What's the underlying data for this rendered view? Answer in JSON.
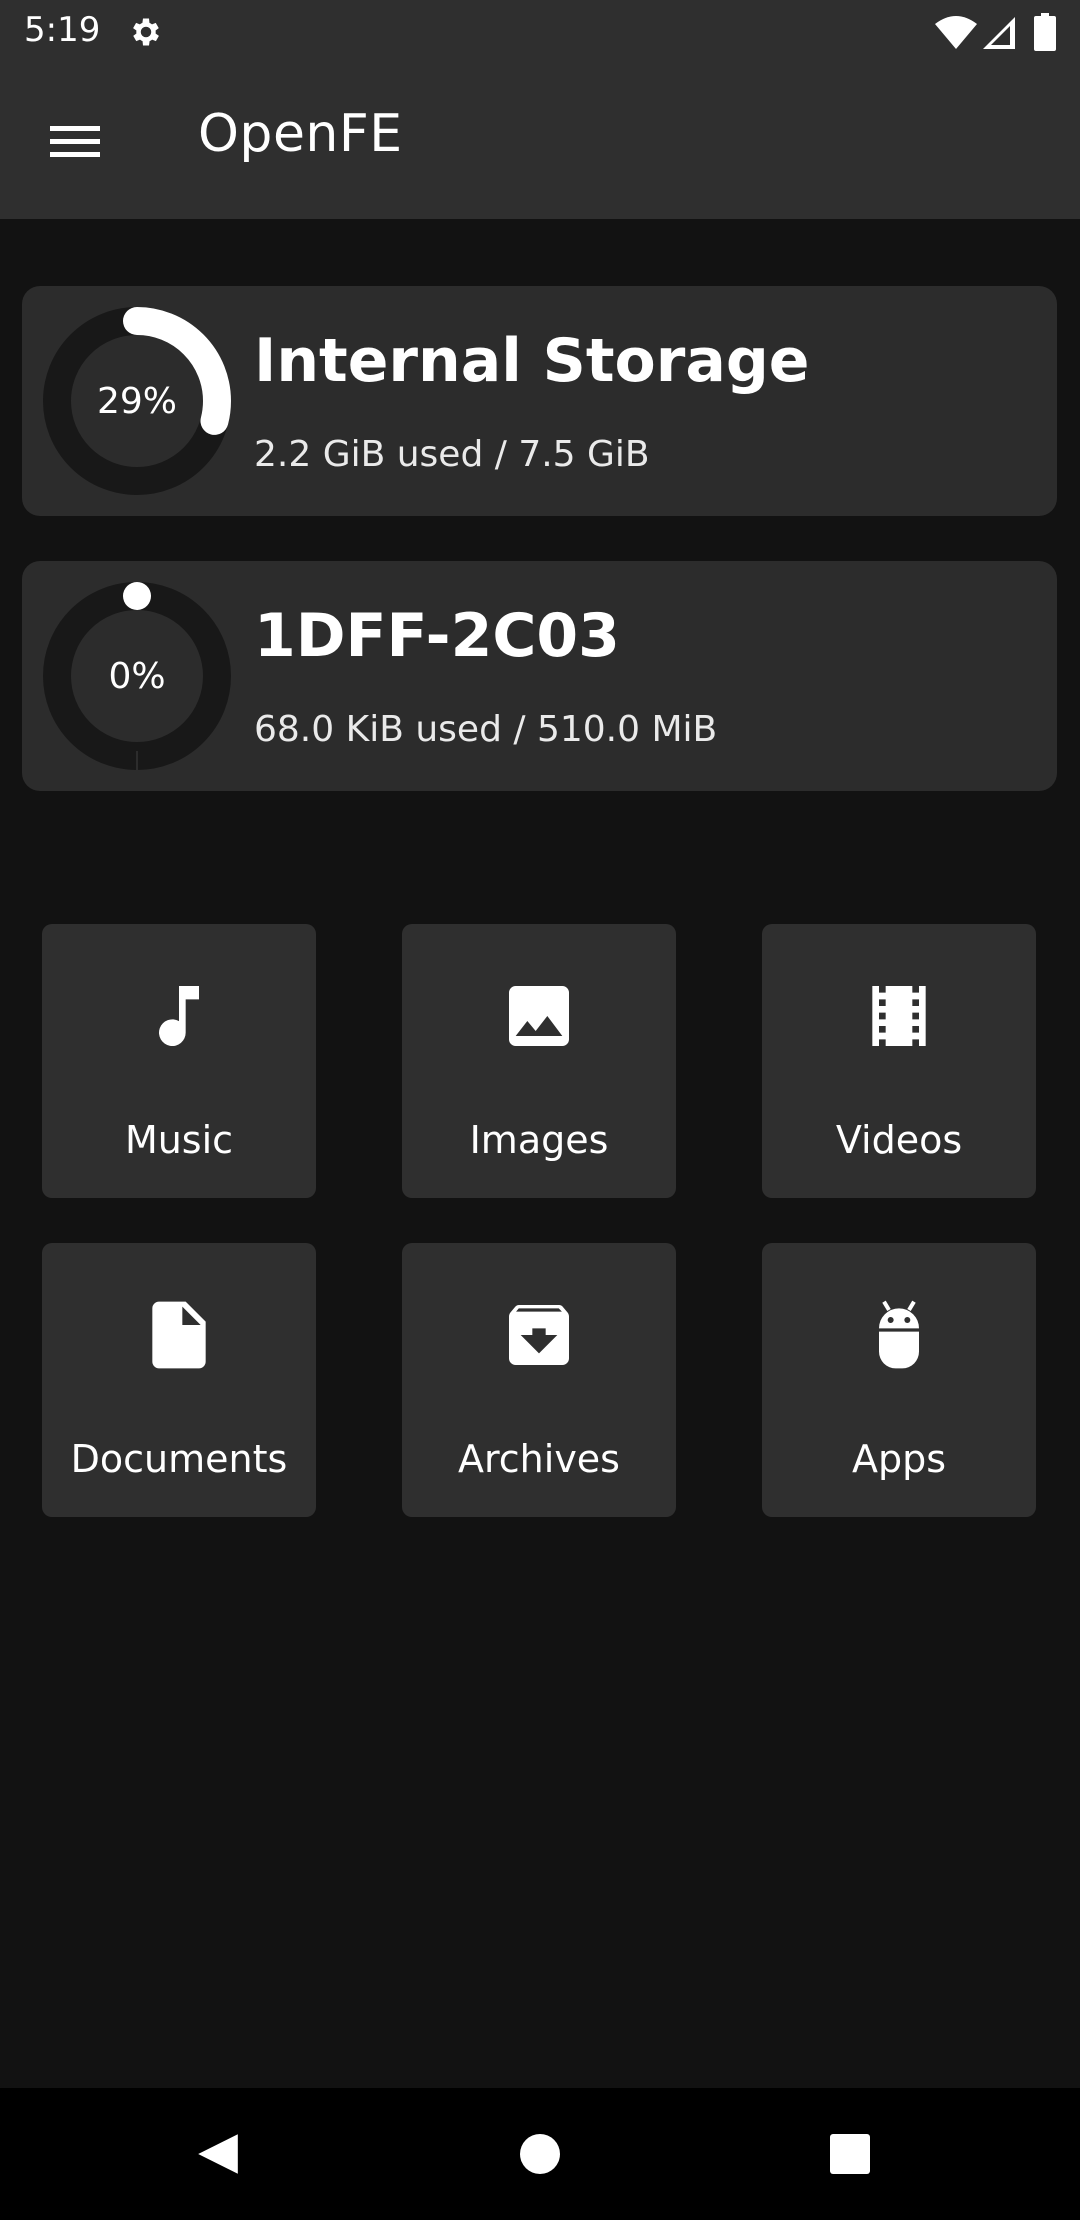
{
  "status_bar": {
    "time": "5:19",
    "icons": [
      "gear-icon",
      "wifi-icon",
      "signal-icon",
      "battery-icon"
    ]
  },
  "app_bar": {
    "title": "OpenFE",
    "menu_icon": "hamburger-menu-icon"
  },
  "storage": [
    {
      "name": "Internal Storage",
      "percent_label": "29%",
      "usage": "2.2 GiB used / 7.5 GiB",
      "fraction_used": 0.29
    },
    {
      "name": "1DFF-2C03",
      "percent_label": "0%",
      "usage": "68.0 KiB used / 510.0 MiB",
      "fraction_used": 0.0
    }
  ],
  "categories": [
    {
      "label": "Music",
      "icon": "music-note-icon"
    },
    {
      "label": "Images",
      "icon": "image-icon"
    },
    {
      "label": "Videos",
      "icon": "film-icon"
    },
    {
      "label": "Documents",
      "icon": "document-icon"
    },
    {
      "label": "Archives",
      "icon": "archive-icon"
    },
    {
      "label": "Apps",
      "icon": "android-icon"
    }
  ],
  "nav_bar": {
    "buttons": [
      "back-icon",
      "home-icon",
      "recents-icon"
    ]
  },
  "colors": {
    "app_bar": "#2f2f2f",
    "background": "#121212",
    "card": "#2c2c2c",
    "ring_track": "#181818",
    "ring_fill": "#ffffff"
  }
}
